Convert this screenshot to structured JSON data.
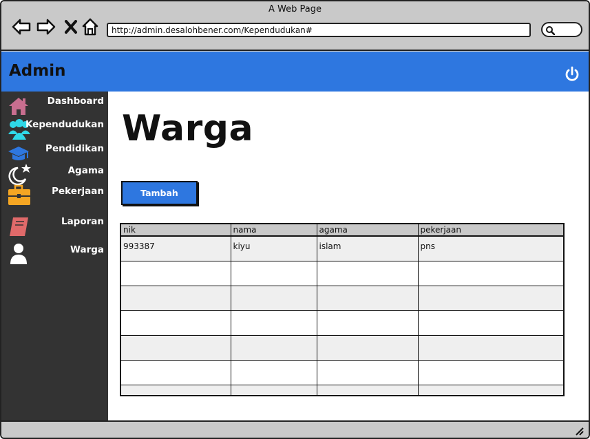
{
  "browser": {
    "title": "A Web Page",
    "url": "http://admin.desalohbener.com/Kependudukan#"
  },
  "header": {
    "title": "Admin"
  },
  "sidebar": {
    "items": [
      {
        "label": "Dashboard",
        "icon": "home-icon",
        "color": "#c86e8f"
      },
      {
        "label": "Kependudukan",
        "icon": "users-icon",
        "color": "#2fd8e8"
      },
      {
        "label": "Pendidikan",
        "icon": "graduation-cap-icon",
        "color": "#2e77e0"
      },
      {
        "label": "Agama",
        "icon": "moon-star-icon",
        "color": "#ffffff"
      },
      {
        "label": "Pekerjaan",
        "icon": "briefcase-icon",
        "color": "#f5a623"
      },
      {
        "label": "Laporan",
        "icon": "book-icon",
        "color": "#e06a6a"
      },
      {
        "label": "Warga",
        "icon": "user-icon",
        "color": "#ffffff"
      }
    ]
  },
  "main": {
    "title": "Warga",
    "add_button": "Tambah",
    "table": {
      "columns": [
        "nik",
        "nama",
        "agama",
        "pekerjaan"
      ],
      "rows": [
        [
          "993387",
          "kiyu",
          "islam",
          "pns"
        ],
        [
          "",
          "",
          "",
          ""
        ],
        [
          "",
          "",
          "",
          ""
        ],
        [
          "",
          "",
          "",
          ""
        ],
        [
          "",
          "",
          "",
          ""
        ],
        [
          "",
          "",
          "",
          ""
        ],
        [
          "",
          "",
          "",
          ""
        ]
      ]
    }
  },
  "colors": {
    "accent": "#2e77e0",
    "sidebar_bg": "#333333",
    "chrome_bg": "#c9c9c9"
  }
}
